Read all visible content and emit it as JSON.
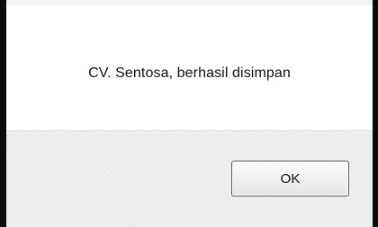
{
  "dialog": {
    "message": "CV. Sentosa, berhasil disimpan",
    "ok_label": "OK"
  }
}
